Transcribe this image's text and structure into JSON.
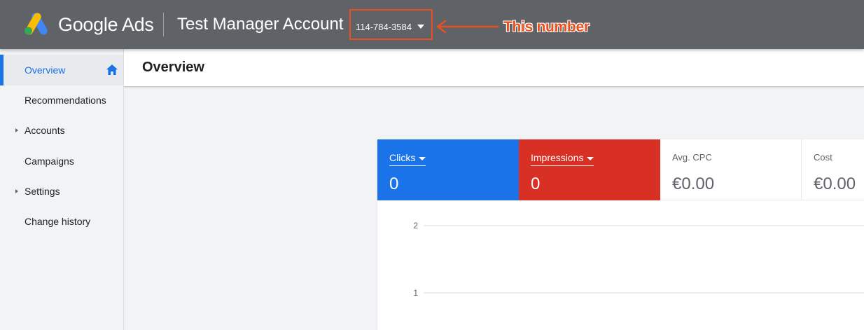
{
  "header": {
    "product_name": "Google Ads",
    "account_name": "Test Manager Account",
    "customer_id": "114-784-3584",
    "callout_text": "This number"
  },
  "sidebar": {
    "items": [
      {
        "label": "Overview",
        "active": true,
        "icon": "home-icon"
      },
      {
        "label": "Recommendations"
      },
      {
        "label": "Accounts",
        "expandable": true
      },
      {
        "label": "Campaigns"
      },
      {
        "label": "Settings",
        "expandable": true
      },
      {
        "label": "Change history"
      }
    ]
  },
  "page": {
    "title": "Overview"
  },
  "metrics": [
    {
      "label": "Clicks",
      "value": "0",
      "color": "#1a73e8"
    },
    {
      "label": "Impressions",
      "value": "0",
      "color": "#d93025"
    },
    {
      "label": "Avg. CPC",
      "value": "€0.00"
    },
    {
      "label": "Cost",
      "value": "€0.00"
    }
  ],
  "colors": {
    "header_bg": "#5f6368",
    "accent_blue": "#1a73e8",
    "accent_red": "#d93025",
    "annotation_orange": "#e8501f"
  },
  "chart_data": {
    "type": "line",
    "y_ticks": [
      "2",
      "1"
    ],
    "ylim": [
      0,
      2
    ],
    "series": [],
    "grid": true
  }
}
